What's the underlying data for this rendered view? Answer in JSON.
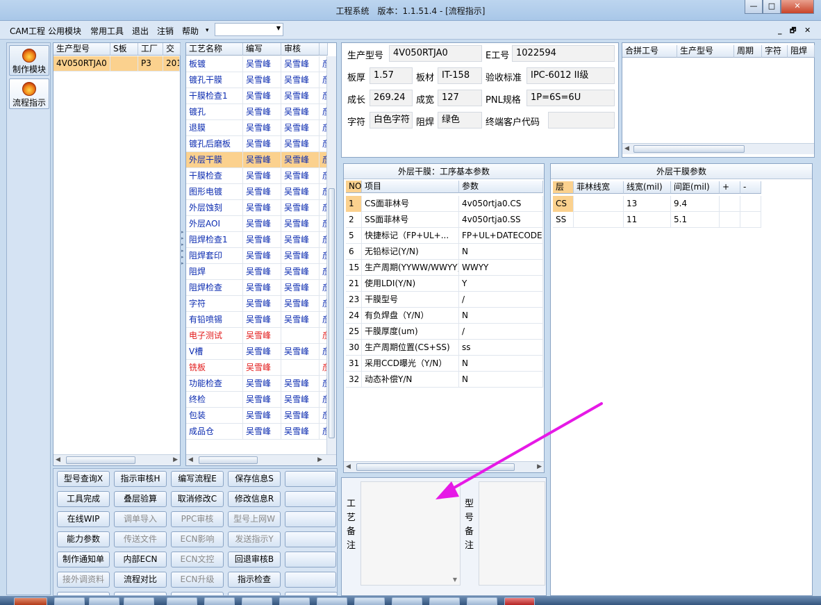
{
  "window": {
    "title": "工程系统　版本：1.1.51.4 - [流程指示]",
    "min_glyph": "—",
    "max_glyph": "□",
    "close_glyph": "✕"
  },
  "menu": {
    "items": [
      "CAM工程",
      "公用模块",
      "常用工具",
      "退出",
      "注销",
      "帮助"
    ],
    "combo_value": "",
    "mdi_min": "_",
    "mdi_restore": "🗗",
    "mdi_close": "✕"
  },
  "nav": {
    "items": [
      {
        "label": "制作模块",
        "icon": "fire-icon"
      },
      {
        "label": "流程指示",
        "icon": "fire-icon"
      }
    ]
  },
  "product_list": {
    "columns": [
      "生产型号",
      "S板",
      "工厂",
      "交"
    ],
    "rows": [
      [
        "4V050RTJA0",
        "",
        "P3",
        "201"
      ]
    ]
  },
  "process_list": {
    "columns": [
      "工艺名称",
      "编写",
      "审核",
      ""
    ],
    "rows": [
      {
        "name": "板镀",
        "writer": "吴雪峰",
        "reviewer": "吴雪峰",
        "extra": "彦",
        "red": false,
        "selected": false
      },
      {
        "name": "镀孔干膜",
        "writer": "吴雪峰",
        "reviewer": "吴雪峰",
        "extra": "彦",
        "red": false,
        "selected": false
      },
      {
        "name": "干膜检查1",
        "writer": "吴雪峰",
        "reviewer": "吴雪峰",
        "extra": "彦",
        "red": false,
        "selected": false
      },
      {
        "name": "镀孔",
        "writer": "吴雪峰",
        "reviewer": "吴雪峰",
        "extra": "彦",
        "red": false,
        "selected": false
      },
      {
        "name": "退膜",
        "writer": "吴雪峰",
        "reviewer": "吴雪峰",
        "extra": "彦",
        "red": false,
        "selected": false
      },
      {
        "name": "镀孔后磨板",
        "writer": "吴雪峰",
        "reviewer": "吴雪峰",
        "extra": "彦",
        "red": false,
        "selected": false
      },
      {
        "name": "外层干膜",
        "writer": "吴雪峰",
        "reviewer": "吴雪峰",
        "extra": "彦",
        "red": false,
        "selected": true
      },
      {
        "name": "干膜检查",
        "writer": "吴雪峰",
        "reviewer": "吴雪峰",
        "extra": "彦",
        "red": false,
        "selected": false
      },
      {
        "name": "图形电镀",
        "writer": "吴雪峰",
        "reviewer": "吴雪峰",
        "extra": "彦",
        "red": false,
        "selected": false
      },
      {
        "name": "外层蚀刻",
        "writer": "吴雪峰",
        "reviewer": "吴雪峰",
        "extra": "彦",
        "red": false,
        "selected": false
      },
      {
        "name": "外层AOI",
        "writer": "吴雪峰",
        "reviewer": "吴雪峰",
        "extra": "彦",
        "red": false,
        "selected": false
      },
      {
        "name": "阻焊检查1",
        "writer": "吴雪峰",
        "reviewer": "吴雪峰",
        "extra": "彦",
        "red": false,
        "selected": false
      },
      {
        "name": "阻焊套印",
        "writer": "吴雪峰",
        "reviewer": "吴雪峰",
        "extra": "彦",
        "red": false,
        "selected": false
      },
      {
        "name": "阻焊",
        "writer": "吴雪峰",
        "reviewer": "吴雪峰",
        "extra": "彦",
        "red": false,
        "selected": false
      },
      {
        "name": "阻焊检查",
        "writer": "吴雪峰",
        "reviewer": "吴雪峰",
        "extra": "彦",
        "red": false,
        "selected": false
      },
      {
        "name": "字符",
        "writer": "吴雪峰",
        "reviewer": "吴雪峰",
        "extra": "彦",
        "red": false,
        "selected": false
      },
      {
        "name": "有铅喷锡",
        "writer": "吴雪峰",
        "reviewer": "吴雪峰",
        "extra": "彦",
        "red": false,
        "selected": false
      },
      {
        "name": "电子测试",
        "writer": "吴雪峰",
        "reviewer": "",
        "extra": "彦",
        "red": true,
        "selected": false
      },
      {
        "name": "V槽",
        "writer": "吴雪峰",
        "reviewer": "吴雪峰",
        "extra": "彦",
        "red": false,
        "selected": false
      },
      {
        "name": "铣板",
        "writer": "吴雪峰",
        "reviewer": "",
        "extra": "彦",
        "red": true,
        "selected": false
      },
      {
        "name": "功能检查",
        "writer": "吴雪峰",
        "reviewer": "吴雪峰",
        "extra": "彦",
        "red": false,
        "selected": false
      },
      {
        "name": "终检",
        "writer": "吴雪峰",
        "reviewer": "吴雪峰",
        "extra": "彦",
        "red": false,
        "selected": false
      },
      {
        "name": "包装",
        "writer": "吴雪峰",
        "reviewer": "吴雪峰",
        "extra": "彦",
        "red": false,
        "selected": false
      },
      {
        "name": "成品仓",
        "writer": "吴雪峰",
        "reviewer": "吴雪峰",
        "extra": "彦",
        "red": false,
        "selected": false
      }
    ]
  },
  "buttons": [
    [
      {
        "label": "型号查询X",
        "enabled": true
      },
      {
        "label": "指示审核H",
        "enabled": true
      },
      {
        "label": "编写流程E",
        "enabled": true
      },
      {
        "label": "保存信息S",
        "enabled": true
      },
      {
        "label": "",
        "enabled": true
      }
    ],
    [
      {
        "label": "工具完成",
        "enabled": true
      },
      {
        "label": "叠层验算",
        "enabled": true
      },
      {
        "label": "取消修改C",
        "enabled": true
      },
      {
        "label": "修改信息R",
        "enabled": true
      },
      {
        "label": "",
        "enabled": true
      }
    ],
    [
      {
        "label": "在线WIP",
        "enabled": true
      },
      {
        "label": "调单导入",
        "enabled": false
      },
      {
        "label": "PPC审核",
        "enabled": false
      },
      {
        "label": "型号上网W",
        "enabled": false
      },
      {
        "label": "",
        "enabled": true
      }
    ],
    [
      {
        "label": "能力参数",
        "enabled": true
      },
      {
        "label": "传送文件",
        "enabled": false
      },
      {
        "label": "ECN影响",
        "enabled": false
      },
      {
        "label": "发送指示Y",
        "enabled": false
      },
      {
        "label": "",
        "enabled": true
      }
    ],
    [
      {
        "label": "制作通知单",
        "enabled": true
      },
      {
        "label": "内部ECN",
        "enabled": true
      },
      {
        "label": "ECN文控",
        "enabled": false
      },
      {
        "label": "回退审核B",
        "enabled": true
      },
      {
        "label": "",
        "enabled": true
      }
    ],
    [
      {
        "label": "接外调资料",
        "enabled": false
      },
      {
        "label": "流程对比",
        "enabled": true
      },
      {
        "label": "ECN升级",
        "enabled": false
      },
      {
        "label": "指示检查",
        "enabled": true
      },
      {
        "label": "",
        "enabled": true
      }
    ]
  ],
  "info": {
    "model_label": "生产型号",
    "model": "4V050RTJA0",
    "eno_label": "E工号",
    "eno": "1022594",
    "thickness_label": "板厚",
    "thickness": "1.57",
    "material_label": "板材",
    "material": "IT-158",
    "standard_label": "验收标准",
    "standard": "IPC-6012 II级",
    "length_label": "成长",
    "length": "269.24",
    "width_label": "成宽",
    "width": "127",
    "pnl_label": "PNL规格",
    "pnl": "1P=6S=6U",
    "char_label": "字符",
    "char": "白色字符",
    "mask_label": "阻焊",
    "mask": "绿色",
    "customer_label": "终端客户代码",
    "customer": ""
  },
  "merge_grid": {
    "columns": [
      "合拼工号",
      "生产型号",
      "周期",
      "字符",
      "阻焊"
    ]
  },
  "basic_params": {
    "title": "外层干膜：工序基本参数",
    "columns": [
      "NO",
      "项目",
      "参数"
    ],
    "rows": [
      [
        "1",
        "CS面菲林号",
        "4v050rtja0.CS"
      ],
      [
        "2",
        "SS面菲林号",
        "4v050rtja0.SS"
      ],
      [
        "5",
        "快捷标记（FP+UL+...",
        "FP+UL+DATECODE"
      ],
      [
        "6",
        "无铅标记(Y/N)",
        "N"
      ],
      [
        "15",
        "生产周期(YYWW/WWYY)",
        "WWYY"
      ],
      [
        "21",
        "使用LDI(Y/N)",
        "Y"
      ],
      [
        "23",
        "干膜型号",
        "/"
      ],
      [
        "24",
        "有负焊盘（Y/N）",
        "N"
      ],
      [
        "25",
        "干膜厚度(um)",
        "/"
      ],
      [
        "30",
        "生产周期位置(CS+SS)",
        "ss"
      ],
      [
        "31",
        "采用CCD曝光（Y/N）",
        "N"
      ],
      [
        "32",
        "动态补偿Y/N",
        "N"
      ]
    ]
  },
  "film_params": {
    "title": "外层干膜参数",
    "columns": [
      "层",
      "菲林线宽",
      "线宽(mil)",
      "间距(mil)",
      "+",
      "-"
    ],
    "rows": [
      [
        "CS",
        "",
        "13",
        "9.4",
        "",
        ""
      ],
      [
        "SS",
        "",
        "11",
        "5.1",
        "",
        ""
      ]
    ]
  },
  "notes": {
    "process_note_label": "工艺备注",
    "model_note_label": "型号备注",
    "process_note": "",
    "model_note": ""
  },
  "annotation": {
    "color": "#e619e6"
  },
  "colors": {
    "selection": "#fbd18e",
    "writer_text": "#0b2bb0",
    "alert_text": "#e21b1b"
  }
}
